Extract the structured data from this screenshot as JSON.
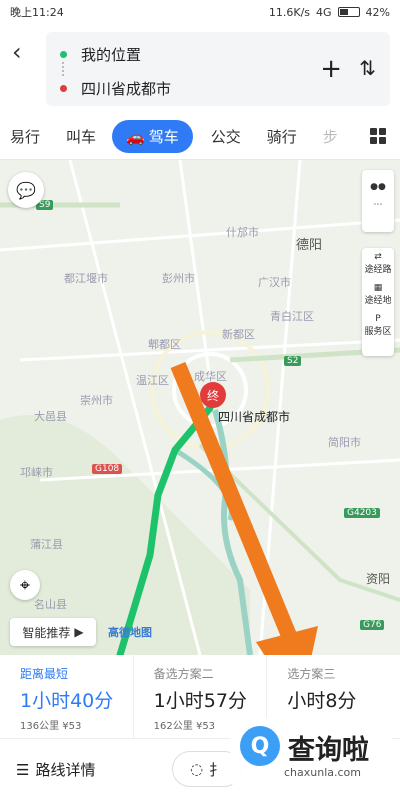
{
  "status": {
    "time": "晚上11:24",
    "speed": "11.6K/s",
    "network": "4G",
    "battery": "42%"
  },
  "header": {
    "from": "我的位置",
    "to": "四川省成都市"
  },
  "tabs": [
    {
      "label": "易行"
    },
    {
      "label": "叫车"
    },
    {
      "label": "驾车"
    },
    {
      "label": "公交"
    },
    {
      "label": "骑行"
    },
    {
      "label": "步"
    }
  ],
  "map": {
    "labels": [
      "都江堰市",
      "彭州市",
      "什邡市",
      "德阳",
      "广汉市",
      "新都区",
      "青白江区",
      "郫都区",
      "温江区",
      "成华区",
      "崇州市",
      "大邑县",
      "邛崃市",
      "蒲江县",
      "简阳市",
      "资阳",
      "名山县"
    ],
    "roads": [
      "S9",
      "S2",
      "G108",
      "G4203",
      "G76"
    ],
    "destination": "四川省成都市",
    "end_marker": "终",
    "side_buttons": [
      "途经路",
      "途经地",
      "服务区"
    ],
    "smart_rec": "智能推荐",
    "logo_text": "高德地图"
  },
  "routes": [
    {
      "tag": "距离最短",
      "duration": "1小时40分",
      "distance": "136公里",
      "cost": "¥53"
    },
    {
      "tag": "备选方案二",
      "duration": "1小时57分",
      "distance": "162公里",
      "cost": "¥53"
    },
    {
      "tag": "选方案三",
      "duration": "小时8分",
      "distance": "",
      "cost": ""
    }
  ],
  "bottom": {
    "detail": "路线详情",
    "other": "扌"
  },
  "watermark": {
    "text": "查询啦",
    "url": "chaxunla.com"
  },
  "colors": {
    "accent": "#2f7bf5",
    "route": "#1ec26a",
    "arrow": "#f07a1e",
    "dest": "#e23b3b"
  }
}
